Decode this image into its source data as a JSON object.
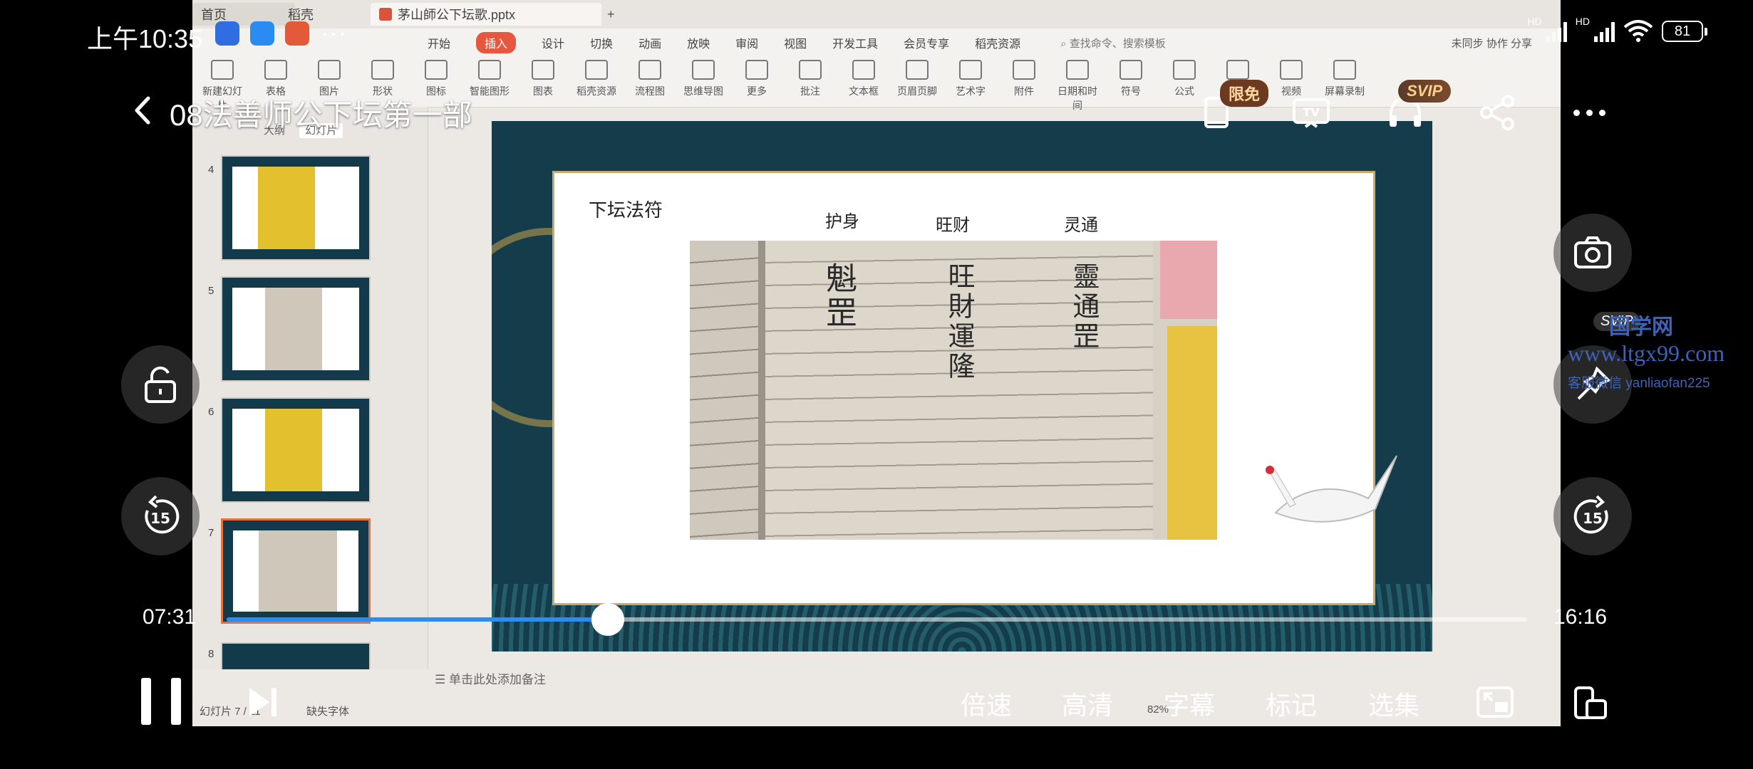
{
  "status_bar": {
    "time": "上午10:35",
    "dots": "···",
    "hd1": "HD",
    "hd2": "HD",
    "battery": "81"
  },
  "player": {
    "title": "08法善师公下坛第一部",
    "badge_limited_free": "限免",
    "badge_svip": "SVIP",
    "current_time": "07:31",
    "total_time": "16:16",
    "progress": 0.293,
    "rewind_label": "15",
    "forward_label": "15",
    "bottom_menu": [
      "倍速",
      "高清",
      "字幕",
      "标记",
      "选集"
    ]
  },
  "watermark": {
    "title": "国学网",
    "svip": "SVIP",
    "site": "www.ltgx99.com",
    "wechat": "客服微信 yanliaofan225"
  },
  "ppt": {
    "file_tab": "茅山師公下坛歌.pptx",
    "tab_home": "首页",
    "tab_app": "稻壳",
    "menu": [
      "开始",
      "插入",
      "设计",
      "切换",
      "动画",
      "放映",
      "审阅",
      "视图",
      "开发工具",
      "会员专享",
      "稻壳资源"
    ],
    "active_menu": "插入",
    "search": "查找命令、搜索模板",
    "right_tools": "未同步  协作  分享",
    "toolbar": [
      "新建幻灯片",
      "表格",
      "图片",
      "形状",
      "图标",
      "智能图形",
      "图表",
      "稻壳资源",
      "流程图",
      "思维导图",
      "更多",
      "批注",
      "文本框",
      "页眉页脚",
      "艺术字",
      "附件",
      "日期和时间",
      "符号",
      "公式",
      "音频",
      "视频",
      "屏幕录制"
    ],
    "panel_tabs": [
      "大纲",
      "幻灯片"
    ],
    "thumb_numbers": [
      "4",
      "5",
      "6",
      "7",
      "8"
    ],
    "notes_placeholder": "单击此处添加备注",
    "status": "幻灯片 7 / 11",
    "missing_font": "缺失字体",
    "zoom": "82%"
  },
  "slide": {
    "title": "下坛法符",
    "columns": [
      "护身",
      "旺财",
      "灵通"
    ],
    "photo_header": "下坛法符",
    "glyph_col1": "魁罡",
    "glyph_col2": "旺財運隆",
    "glyph_col3": "靈通罡"
  },
  "colors": {
    "progress": "#2e8cf0",
    "badge_svip": "#ffcf8a",
    "ppt_accent": "#e8563f",
    "slide_bg": "#153c4b",
    "watermark": "#3e63b6"
  }
}
